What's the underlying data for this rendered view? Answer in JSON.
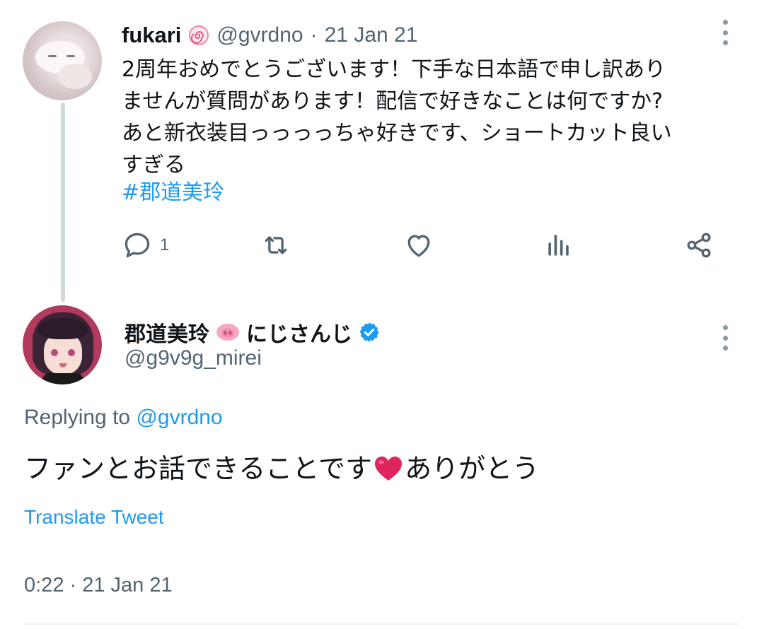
{
  "colors": {
    "text": "#0f1419",
    "secondary": "#536471",
    "link": "#1d9bf0",
    "verified": "#1d9bf0",
    "heart": "#e0245e",
    "thread_line": "#cfd9de"
  },
  "original_tweet": {
    "display_name": "fukari",
    "name_emoji": "spiral-emoji",
    "handle": "@gvrdno",
    "separator": "·",
    "date": "21 Jan 21",
    "body_lines": [
      "2周年おめでとうございます！下手な日本語で申し訳あり",
      "ませんが質問があります！配信で好きなことは何ですか?",
      "あと新衣装目っっっっちゃ好きです、ショートカット良い",
      "すぎる"
    ],
    "hashtag": "#郡道美玲",
    "actions": {
      "reply_icon": "reply-icon",
      "reply_count": "1",
      "retweet_icon": "retweet-icon",
      "like_icon": "heart-outline-icon",
      "analytics_icon": "analytics-icon",
      "share_icon": "share-icon"
    }
  },
  "reply_tweet": {
    "display_name": "郡道美玲",
    "name_emoji": "pig-nose-emoji",
    "display_name_suffix": "にじさんじ",
    "verified_icon": "verified-badge-icon",
    "handle": "@g9v9g_mirei",
    "replying_prefix": "Replying to",
    "replying_to": "@gvrdno",
    "text_before_emoji": "ファンとお話できることです",
    "emoji": "red-heart-emoji",
    "text_after_emoji": "ありがとう",
    "translate_label": "Translate Tweet",
    "timestamp": "0:22 · 21 Jan 21"
  }
}
